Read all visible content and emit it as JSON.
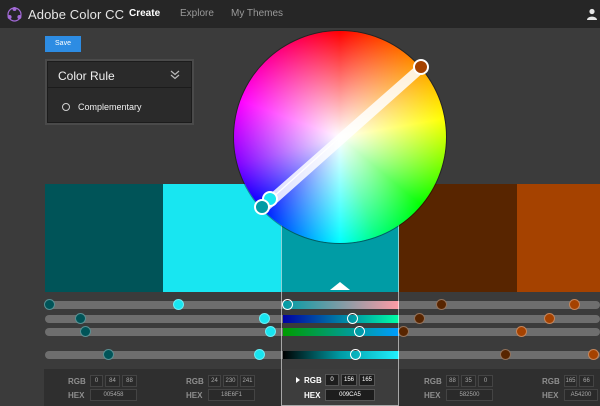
{
  "app": {
    "title": "Adobe Color CC",
    "nav": [
      "Create",
      "Explore",
      "My Themes"
    ],
    "active_nav": "Create"
  },
  "toolbar": {
    "save_label": "Save"
  },
  "color_rule": {
    "title": "Color Rule",
    "selected": "Complementary"
  },
  "swatches": [
    {
      "hex": "005458",
      "rgb": [
        0,
        84,
        88
      ]
    },
    {
      "hex": "18E6F1",
      "rgb": [
        24,
        230,
        241
      ]
    },
    {
      "hex": "009CA5",
      "rgb": [
        0,
        156,
        165
      ],
      "selected": true
    },
    {
      "hex": "582500",
      "rgb": [
        88,
        35,
        0
      ]
    },
    {
      "hex": "A54200",
      "rgb": [
        165,
        66,
        0
      ]
    }
  ],
  "labels": {
    "rgb": "RGB",
    "hex": "HEX"
  },
  "colors": {
    "topbar": "#262626",
    "background": "#3b3b3b",
    "accent": "#2d8ce3"
  },
  "icons": {
    "logo": "adobe-color-wheel-logo",
    "user": "user-icon",
    "chevron": "double-chevron-down-icon",
    "radio": "radio-button-icon",
    "selected_arrow": "play-triangle-icon"
  }
}
